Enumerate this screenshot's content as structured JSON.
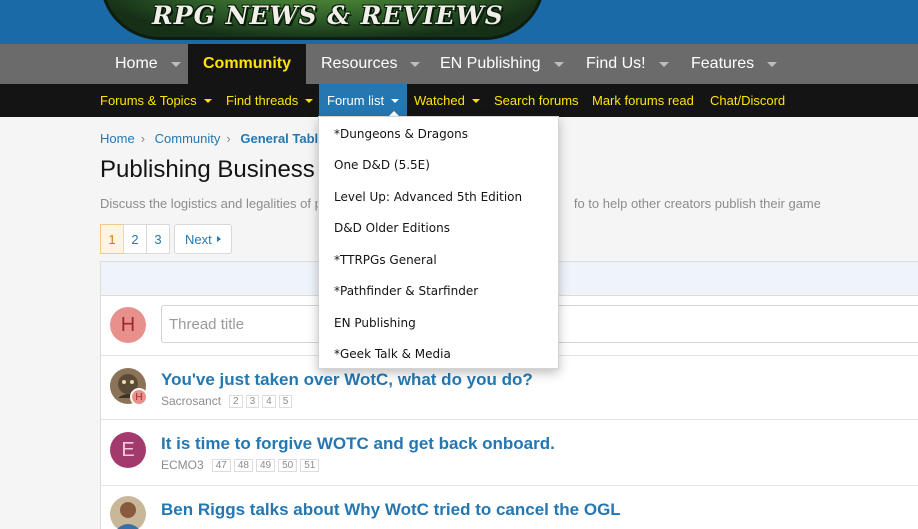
{
  "banner": {
    "logo_text": "RPG NEWS & REVIEWS"
  },
  "main_nav": [
    {
      "label": "Home"
    },
    {
      "label": "Community"
    },
    {
      "label": "Resources"
    },
    {
      "label": "EN Publishing"
    },
    {
      "label": "Find Us!"
    },
    {
      "label": "Features"
    }
  ],
  "sub_nav": [
    {
      "label": "Forums & Topics"
    },
    {
      "label": "Find threads"
    },
    {
      "label": "Forum list"
    },
    {
      "label": "Watched"
    },
    {
      "label": "Search forums"
    },
    {
      "label": "Mark forums read"
    },
    {
      "label": "Chat/Discord"
    }
  ],
  "breadcrumb": [
    "Home",
    "Community",
    "General Table"
  ],
  "page": {
    "title": "Publishing Business &",
    "description_left": "Discuss the logistics and legalities of p",
    "description_right": "fo to help other creators publish their games."
  },
  "pagination": {
    "pages": [
      "1",
      "2",
      "3"
    ],
    "current": "1",
    "next": "Next"
  },
  "new_thread": {
    "avatar_letter": "H",
    "placeholder": "Thread title"
  },
  "threads": [
    {
      "title": "You've just taken over WotC, what do you do?",
      "author": "Sacrosanct",
      "pages": [
        "2",
        "3",
        "4",
        "5"
      ],
      "badge": "H"
    },
    {
      "title": "It is time to forgive WOTC and get back onboard.",
      "author": "ECMO3",
      "pages": [
        "47",
        "48",
        "49",
        "50",
        "51"
      ],
      "avatar_letter": "E"
    },
    {
      "title": "Ben Riggs talks about Why WotC tried to cancel the OGL",
      "author": "",
      "pages": []
    }
  ],
  "forum_list_dropdown": [
    "*Dungeons & Dragons",
    "One D&D (5.5E)",
    "Level Up: Advanced 5th Edition",
    "D&D Older Editions",
    "*TTRPGs General",
    "*Pathfinder & Starfinder",
    "EN Publishing",
    "*Geek Talk & Media"
  ],
  "colors": {
    "accent": "#2577b1",
    "nav_active_text": "#ffe400",
    "nav_bg": "#6b6b6b",
    "subnav_bg": "#141414"
  }
}
